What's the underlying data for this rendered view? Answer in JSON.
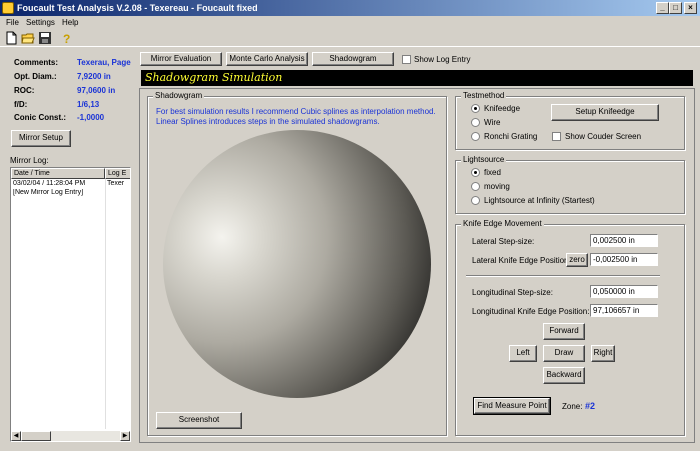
{
  "window": {
    "title": "Foucault Test Analysis V.2.08 - Texereau - Foucault fixed"
  },
  "menu": [
    "File",
    "Settings",
    "Help"
  ],
  "toolbar": {
    "icons": [
      "new-file-icon",
      "open-folder-icon",
      "save-disk-icon",
      "help-icon"
    ]
  },
  "mirror": {
    "comments_label": "Comments:",
    "comments_value": "Texerau, Page",
    "diam_label": "Opt. Diam.:",
    "diam_value": "7,9200 in",
    "roc_label": "ROC:",
    "roc_value": "97,0600 in",
    "fd_label": "f/D:",
    "fd_value": "1/6,13",
    "conic_label": "Conic Const.:",
    "conic_value": "-1,0000",
    "setup_button": "Mirror Setup"
  },
  "log": {
    "title": "Mirror Log:",
    "columns": [
      "Date / Time",
      "Log E"
    ],
    "rows": [
      {
        "date": "03/02/04 / 11:28:04 PM",
        "entry": "Texer"
      },
      {
        "date": "[New Mirror Log Entry]",
        "entry": ""
      }
    ]
  },
  "tabs": {
    "mirror_eval": "Mirror Evaluation",
    "monte_carlo": "Monte Carlo Analysis",
    "shadowgram": "Shadowgram",
    "show_log": "Show Log Entry"
  },
  "sim_title": "Shadowgram Simulation",
  "shadowgram": {
    "group_title": "Shadowgram",
    "hint": "For best simulation results I recommend Cubic splines as interpolation method. Linear Splines introduces steps in the simulated shadowgrams.",
    "screenshot_button": "Screenshot"
  },
  "testmethod": {
    "title": "Testmethod",
    "options": [
      "Knifeedge",
      "Wire",
      "Ronchi Grating"
    ],
    "selected": "Knifeedge",
    "setup_button": "Setup Knifeedge",
    "couder_label": "Show Couder Screen"
  },
  "lightsource": {
    "title": "Lightsource",
    "options": [
      "fixed",
      "moving",
      "Lightsource at Infinity (Startest)"
    ],
    "selected": "fixed"
  },
  "knife": {
    "title": "Knife Edge Movement",
    "lat_step_label": "Lateral Step-size:",
    "lat_step_value": "0,002500 in",
    "lat_pos_label": "Lateral Knife Edge Position:",
    "zero_label": "zero",
    "lat_pos_value": "-0,002500 in",
    "long_step_label": "Longitudinal Step-size:",
    "long_step_value": "0,050000 in",
    "long_pos_label": "Longitudinal Knife Edge Position:",
    "long_pos_value": "97,106657 in",
    "forward": "Forward",
    "left": "Left",
    "draw": "Draw",
    "right": "Right",
    "backward": "Backward",
    "find_button": "Find Measure Point",
    "zone_label": "Zone:",
    "zone_value": "#2"
  },
  "colors": {
    "accent_value": "#1a33d6",
    "sim_title_bg": "#000000",
    "sim_title_fg": "#ffff33"
  }
}
